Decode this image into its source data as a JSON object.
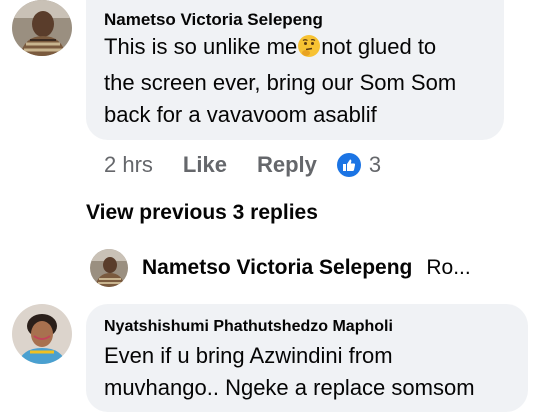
{
  "comment1": {
    "author": "Nametso Victoria Selepeng",
    "line1_before": "This is so unlike me",
    "emoji_icon": "thinking-face-icon",
    "line1_after": "not glued to",
    "line2": "the screen ever, bring our Som Som",
    "line3": "back for a vavavoom asablif",
    "time": "2 hrs",
    "like_label": "Like",
    "reply_label": "Reply",
    "reaction_icon": "thumbs-up-icon",
    "reaction_count": "3"
  },
  "view_previous": "View previous 3 replies",
  "reply_preview": {
    "author": "Nametso Victoria Selepeng",
    "snippet": "Ro..."
  },
  "comment2": {
    "author": "Nyatshishumi Phathutshedzo Mapholi",
    "line1": "Even if u bring Azwindini from",
    "line2": "muvhango.. Ngeke a replace somsom"
  },
  "colors": {
    "bubble": "#f0f2f5",
    "meta_text": "#65676b",
    "like_blue": "#1b74e4"
  }
}
